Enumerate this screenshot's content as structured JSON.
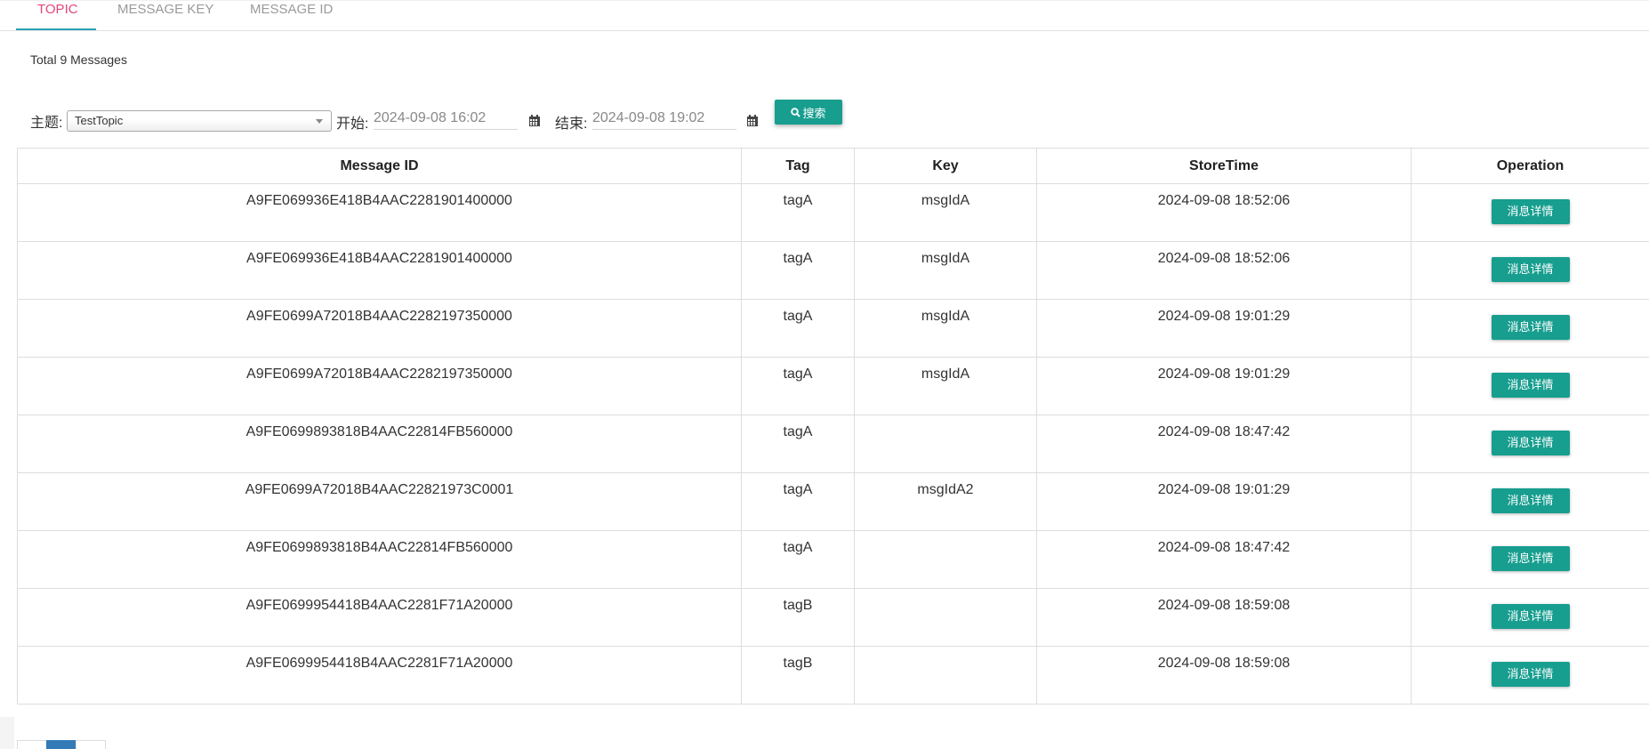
{
  "tabs": [
    {
      "label": "TOPIC"
    },
    {
      "label": "MESSAGE KEY"
    },
    {
      "label": "MESSAGE ID"
    }
  ],
  "summary": {
    "total_text": "Total 9 Messages"
  },
  "search": {
    "topic_label": "主题:",
    "topic_value": "TestTopic",
    "start_label": "开始:",
    "start_value": "2024-09-08 16:02",
    "end_label": "结束:",
    "end_value": "2024-09-08 19:02",
    "search_button": "搜索",
    "icons": {
      "search": "search-icon",
      "calendar": "calendar-icon",
      "dropdown": "chevron-down-icon"
    }
  },
  "table": {
    "headers": [
      "Message ID",
      "Tag",
      "Key",
      "StoreTime",
      "Operation"
    ],
    "rows": [
      {
        "id": "A9FE069936E418B4AAC2281901400000",
        "tag": "tagA",
        "key": "msgIdA",
        "time": "2024-09-08 18:52:06",
        "action": "消息详情"
      },
      {
        "id": "A9FE069936E418B4AAC2281901400000",
        "tag": "tagA",
        "key": "msgIdA",
        "time": "2024-09-08 18:52:06",
        "action": "消息详情"
      },
      {
        "id": "A9FE0699A72018B4AAC2282197350000",
        "tag": "tagA",
        "key": "msgIdA",
        "time": "2024-09-08 19:01:29",
        "action": "消息详情"
      },
      {
        "id": "A9FE0699A72018B4AAC2282197350000",
        "tag": "tagA",
        "key": "msgIdA",
        "time": "2024-09-08 19:01:29",
        "action": "消息详情"
      },
      {
        "id": "A9FE0699893818B4AAC22814FB560000",
        "tag": "tagA",
        "key": "",
        "time": "2024-09-08 18:47:42",
        "action": "消息详情"
      },
      {
        "id": "A9FE0699A72018B4AAC22821973C0001",
        "tag": "tagA",
        "key": "msgIdA2",
        "time": "2024-09-08 19:01:29",
        "action": "消息详情"
      },
      {
        "id": "A9FE0699893818B4AAC22814FB560000",
        "tag": "tagA",
        "key": "",
        "time": "2024-09-08 18:47:42",
        "action": "消息详情"
      },
      {
        "id": "A9FE0699954418B4AAC2281F71A20000",
        "tag": "tagB",
        "key": "",
        "time": "2024-09-08 18:59:08",
        "action": "消息详情"
      },
      {
        "id": "A9FE0699954418B4AAC2281F71A20000",
        "tag": "tagB",
        "key": "",
        "time": "2024-09-08 18:59:08",
        "action": "消息详情"
      }
    ]
  },
  "colors": {
    "accent": "#179e8f",
    "active_tab": "#e0487a",
    "tab_underline": "#2aa2b5",
    "pager_active": "#337ab7"
  }
}
